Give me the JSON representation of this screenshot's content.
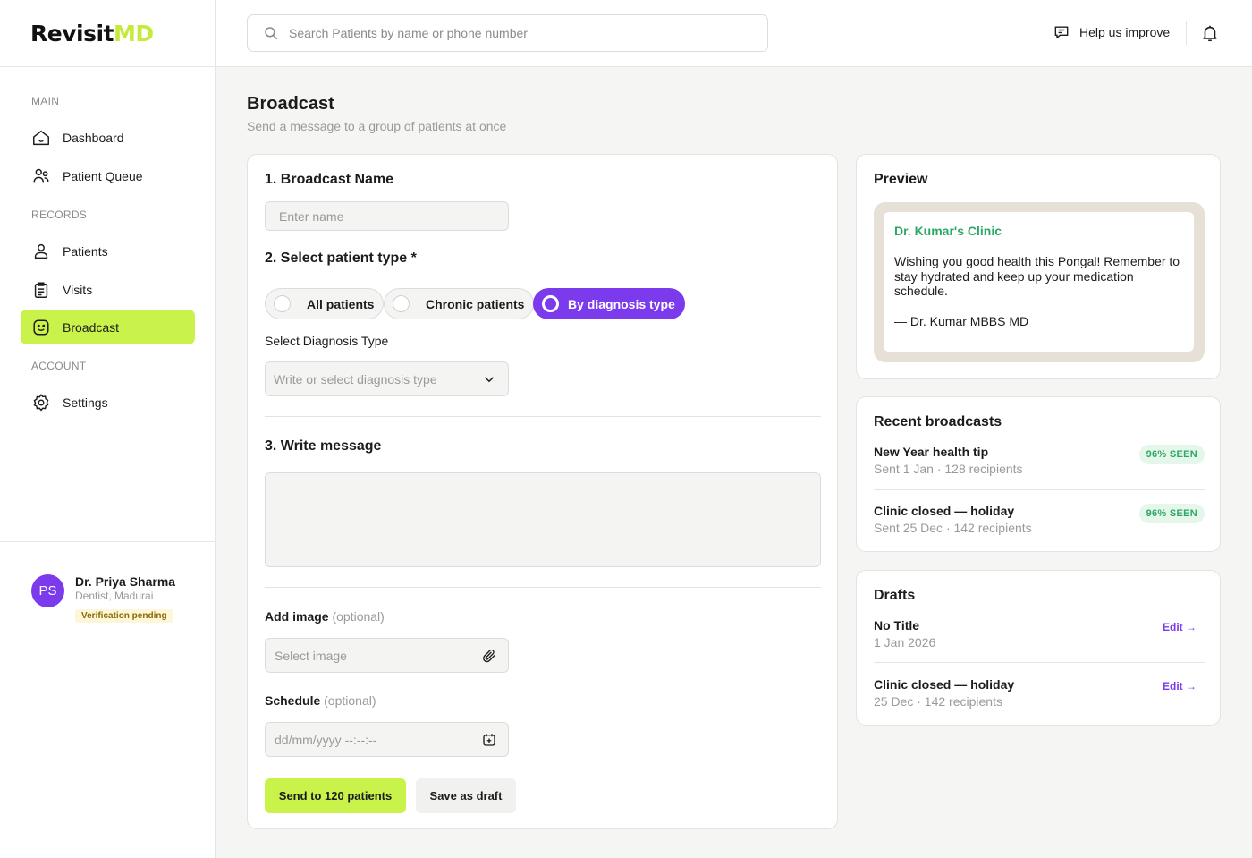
{
  "brand": {
    "logo_main": "Revisit",
    "logo_accent": "MD"
  },
  "sidebar": {
    "section_main": "MAIN",
    "section_records": "RECORDS",
    "section_account": "ACCOUNT",
    "items": [
      {
        "label": "Dashboard",
        "icon": "home-icon"
      },
      {
        "label": "Patient Queue",
        "icon": "users-icon"
      },
      {
        "label": "Patients",
        "icon": "user-icon"
      },
      {
        "label": "Visits",
        "icon": "clipboard-icon"
      },
      {
        "label": "Broadcast",
        "icon": "broadcast-icon",
        "active": true
      },
      {
        "label": "Settings",
        "icon": "gear-icon"
      }
    ],
    "user": {
      "initials": "PS",
      "name": "Dr. Priya Sharma",
      "role": "Dentist, Madurai",
      "badge": "Verification pending"
    }
  },
  "topbar": {
    "search_placeholder": "Search Patients by name or phone number",
    "help_label": "Help us improve"
  },
  "page": {
    "title": "Broadcast",
    "subtitle": "Send a message to a group of patients at once"
  },
  "form": {
    "step1_title": "1. Broadcast Name",
    "name_placeholder": "Enter name",
    "step2_title": "2. Select patient type *",
    "patient_types": [
      "All patients",
      "Chronic patients",
      "By diagnosis type"
    ],
    "selected_type": "By diagnosis type",
    "diagnosis_label": "Select Diagnosis Type",
    "diagnosis_placeholder": "Write or select diagnosis type",
    "step3_title": "3. Write message",
    "image_label": "Add image",
    "image_optional": "(optional)",
    "image_placeholder": "Select image",
    "schedule_label": "Schedule",
    "schedule_optional": "(optional)",
    "schedule_placeholder": "dd/mm/yyyy --:--:--",
    "send_button": "Send to 120 patients",
    "draft_button": "Save as draft"
  },
  "preview": {
    "title": "Preview",
    "clinic": "Dr. Kumar's Clinic",
    "body": "Wishing you good health this Pongal! Remember to stay hydrated and keep up your medication schedule.",
    "signature": "— Dr. Kumar MBBS MD"
  },
  "recent": {
    "title": "Recent broadcasts",
    "items": [
      {
        "name": "New Year health tip",
        "meta": "Sent 1 Jan · 128 recipients",
        "badge": "96% SEEN"
      },
      {
        "name": "Clinic closed — holiday",
        "meta": "Sent 25 Dec · 142 recipients",
        "badge": "96% SEEN"
      }
    ]
  },
  "drafts": {
    "title": "Drafts",
    "edit_label": "Edit →",
    "items": [
      {
        "name": "No Title",
        "meta": "1 Jan 2026"
      },
      {
        "name": "Clinic closed — holiday",
        "meta": "25 Dec · 142 recipients"
      }
    ]
  },
  "colors": {
    "accent_lime": "#c9f24a",
    "accent_purple": "#7c3aed",
    "success_green": "#2ea866"
  }
}
